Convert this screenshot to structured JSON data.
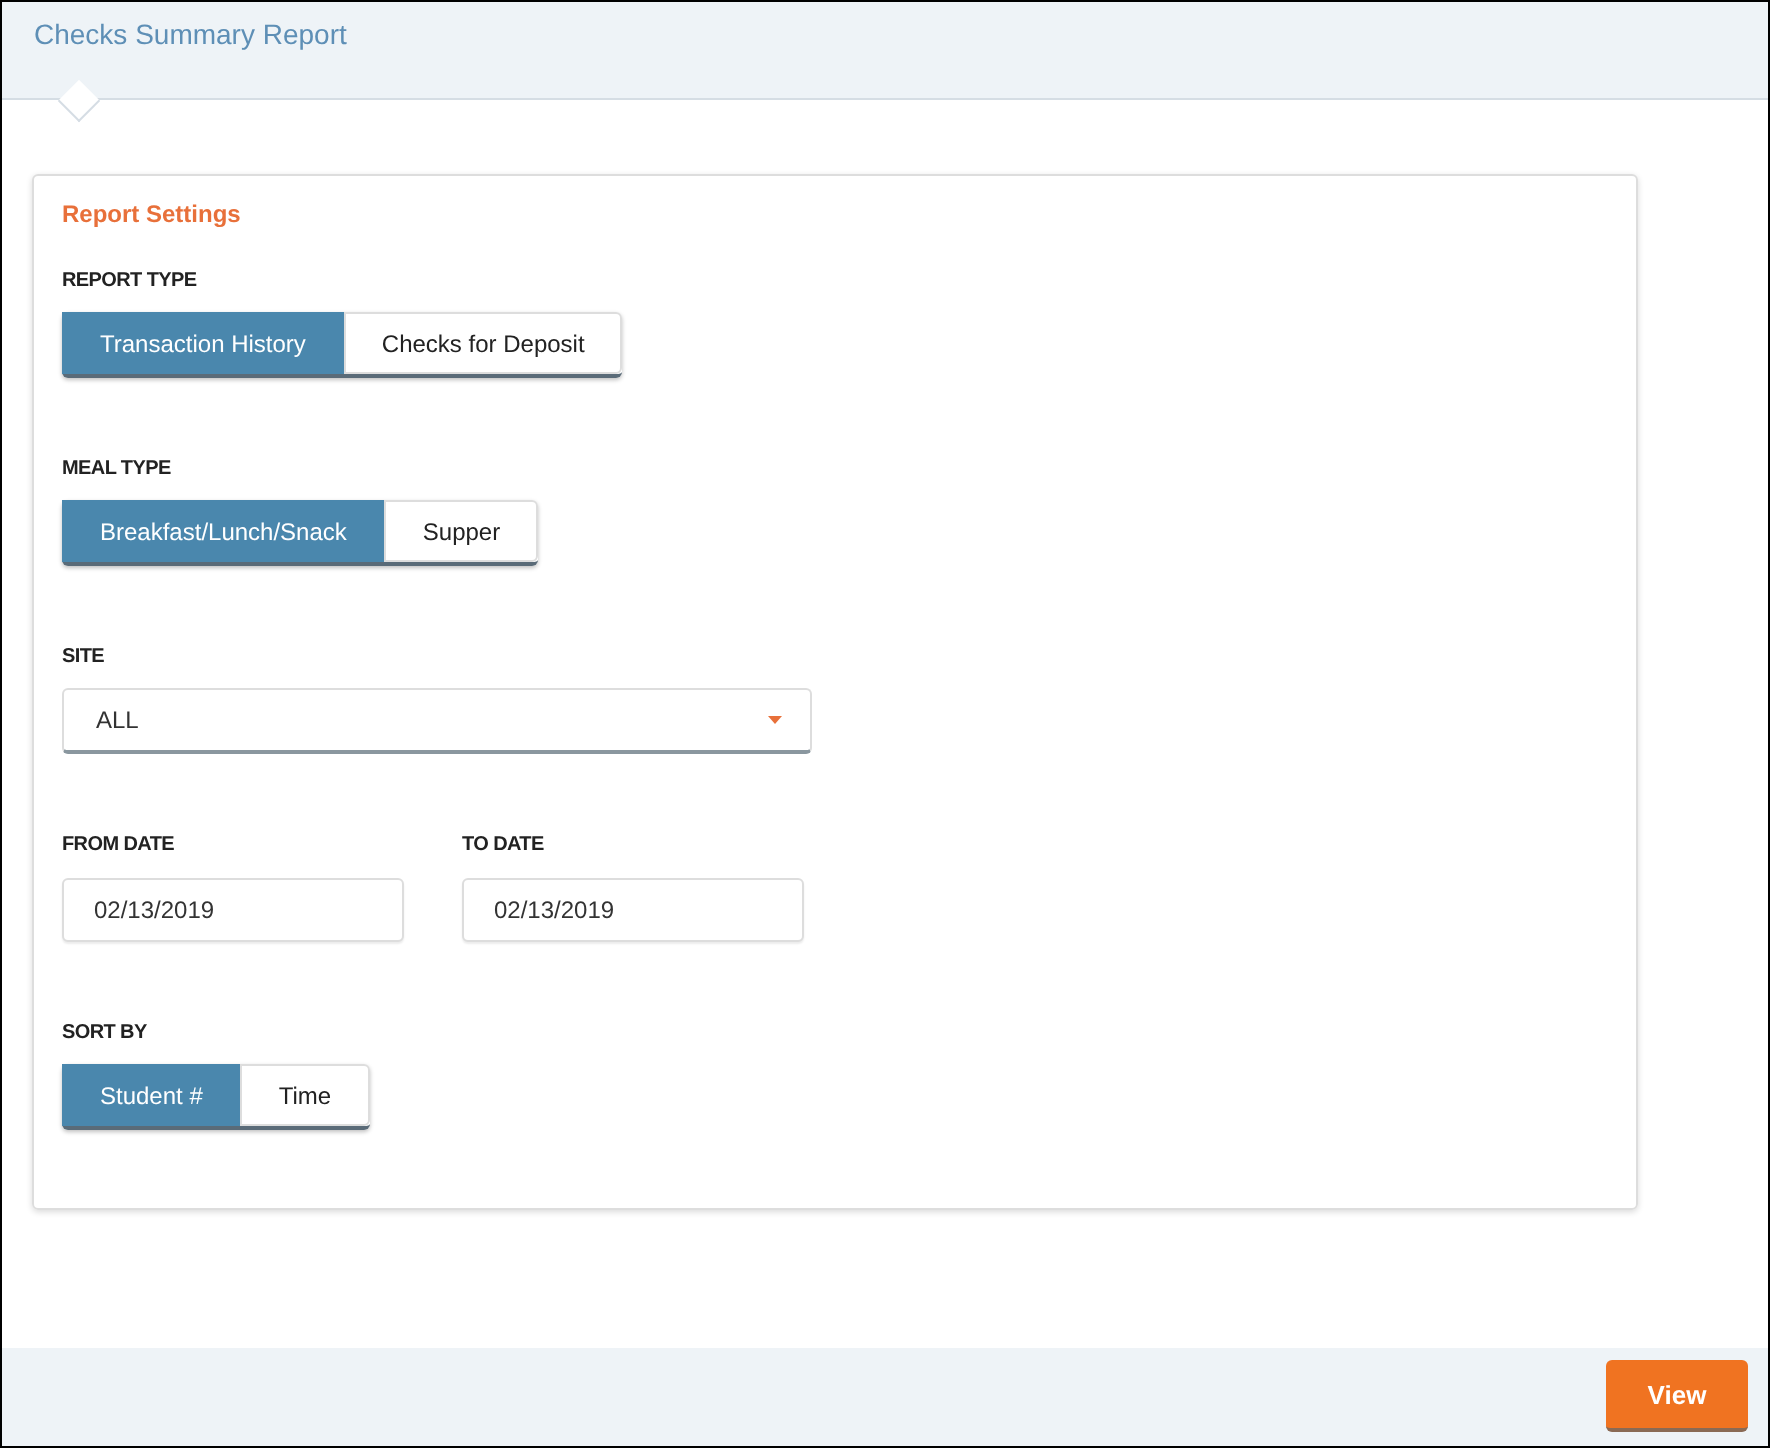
{
  "header": {
    "title": "Checks Summary Report"
  },
  "settings": {
    "title": "Report Settings",
    "fields": [
      {
        "kind": "toggle",
        "label": "REPORT TYPE",
        "options": [
          {
            "label": "Transaction History",
            "selected": true
          },
          {
            "label": "Checks for Deposit",
            "selected": false
          }
        ]
      },
      {
        "kind": "toggle",
        "label": "MEAL TYPE",
        "options": [
          {
            "label": "Breakfast/Lunch/Snack",
            "selected": true
          },
          {
            "label": "Supper",
            "selected": false
          }
        ]
      },
      {
        "kind": "select",
        "label": "SITE",
        "value": "ALL"
      },
      {
        "kind": "dates",
        "items": [
          {
            "label": "FROM DATE",
            "value": "02/13/2019"
          },
          {
            "label": "TO DATE",
            "value": "02/13/2019"
          }
        ]
      },
      {
        "kind": "toggle",
        "label": "SORT BY",
        "options": [
          {
            "label": "Student #",
            "selected": true
          },
          {
            "label": "Time",
            "selected": false
          }
        ]
      }
    ]
  },
  "footer": {
    "buttons": [
      "View"
    ]
  }
}
